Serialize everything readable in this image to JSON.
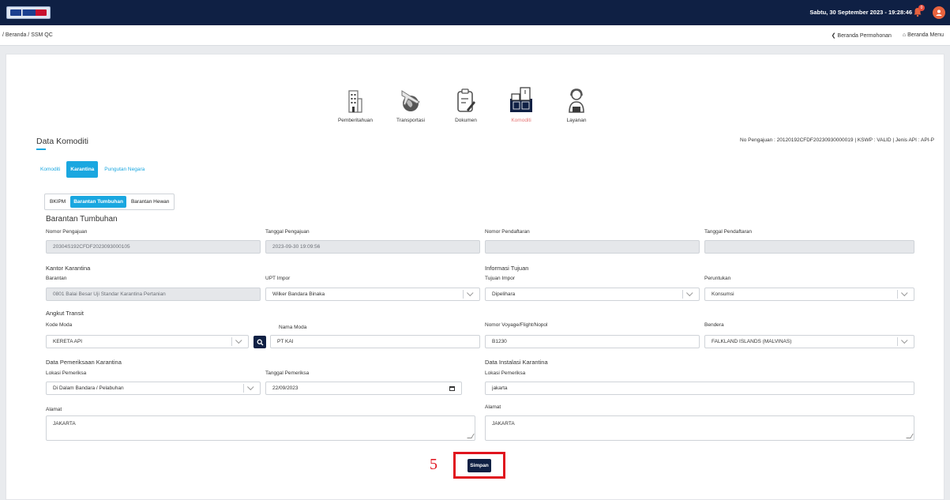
{
  "header": {
    "datetime": "Sabtu, 30 September 2023 - 19:28:46",
    "notification_count": "0"
  },
  "breadcrumb": "/ Beranda / SSM QC",
  "nav": {
    "back_label": "❮ Beranda Permohonan",
    "home_label": "⌂ Beranda Menu"
  },
  "wizard": {
    "steps": [
      "Pemberitahuan",
      "Transportasi",
      "Dokumen",
      "Komoditi",
      "Layanan"
    ]
  },
  "page": {
    "title": "Data Komoditi",
    "info": "No Pengajuan : 20120192CFDF20230930000019 | KSWP : VALID | Jenis API : API-P"
  },
  "tabs": [
    "Komoditi",
    "Karantina",
    "Pungutan Negara"
  ],
  "subtabs": [
    "BKIPM",
    "Barantan Tumbuhan",
    "Barantan Hewan"
  ],
  "form": {
    "section_title": "Barantan Tumbuhan",
    "nomor_pengajuan_label": "Nomor Pengajuan",
    "nomor_pengajuan": "20304S192CFDF2023093000105",
    "tanggal_pengajuan_label": "Tanggal Pengajuan",
    "tanggal_pengajuan": "2023-09-30 19:09:56",
    "nomor_pendaftaran_label": "Nomor Pendaftaran",
    "nomor_pendaftaran": "",
    "tanggal_pendaftaran_label": "Tanggal Pendaftaran",
    "tanggal_pendaftaran": "",
    "kantor_title": "Kantor Karantina",
    "barantan_label": "Barantan",
    "barantan": "0801 Balai Besar Uji Standar Karantina Pertanian",
    "upt_label": "UPT Impor",
    "upt": "Wilker Bandara Binaka",
    "info_tujuan_title": "Informasi Tujuan",
    "tujuan_label": "Tujuan Impor",
    "tujuan": "Dipelihara",
    "peruntukan_label": "Peruntukan",
    "peruntukan": "Konsumsi",
    "angkut_title": "Angkut Transit",
    "kode_moda_label": "Kode Moda",
    "kode_moda": "KERETA API",
    "nama_moda_label": "Nama Moda",
    "nama_moda": "PT KAI",
    "voyage_label": "Nomor Voyage/Flight/Nopol",
    "voyage": "B1230",
    "bendera_label": "Bendera",
    "bendera": "FALKLAND ISLANDS (MALVINAS)",
    "pemeriksaan_title": "Data Pemeriksaan Karantina",
    "lokasi_label": "Lokasi Pemeriksa",
    "lokasi": "Di Dalam Bandara / Pelabuhan",
    "tanggal_periksa_label": "Tanggal Pemeriksa",
    "tanggal_periksa": "22/09/2023",
    "instalasi_title": "Data Instalasi Karantina",
    "lokasi2_label": "Lokasi Pemeriksa",
    "lokasi2": "jakarta",
    "alamat_label": "Alamat",
    "alamat": "JAKARTA",
    "alamat2_label": "Alamat",
    "alamat2": "JAKARTA"
  },
  "actions": {
    "save_label": "Simpan",
    "annotation": "5"
  },
  "colors": {
    "navy": "#0f2044",
    "accent": "#1aa7e0",
    "highlight": "#e0141e"
  }
}
